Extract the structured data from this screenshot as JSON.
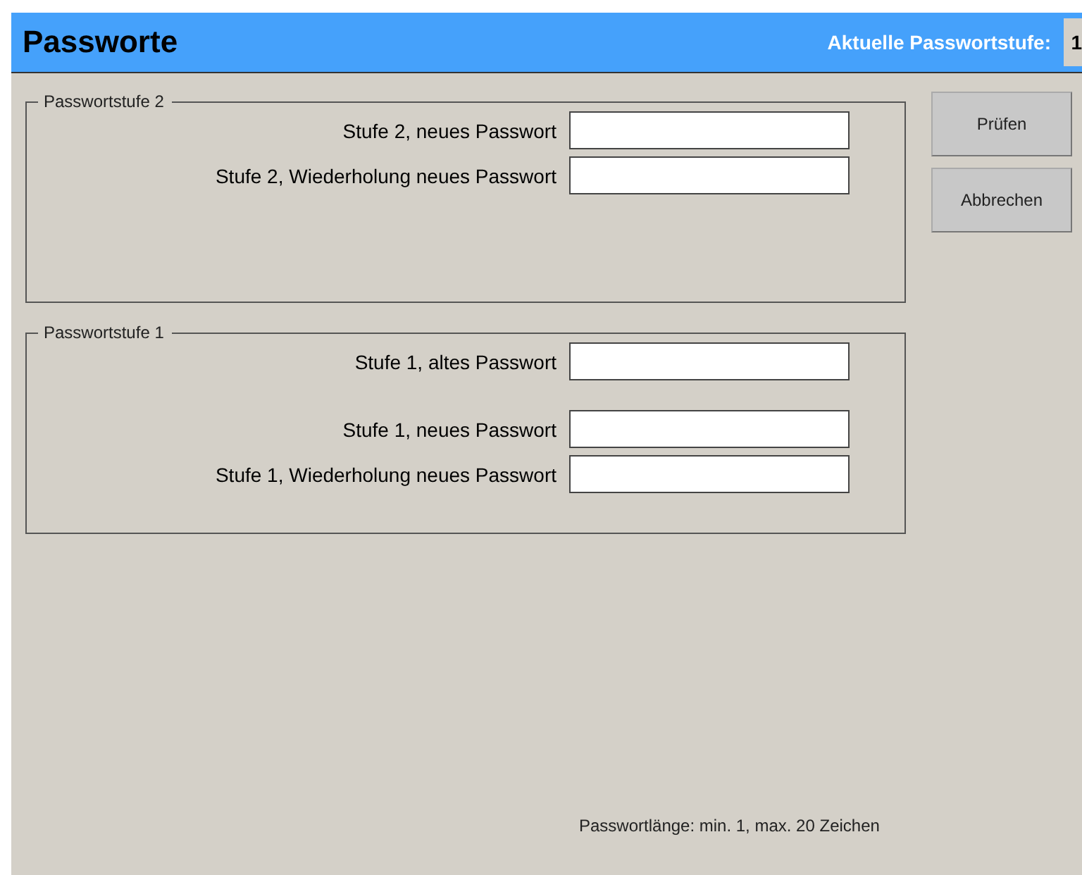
{
  "header": {
    "title": "Passworte",
    "level_label": "Aktuelle Passwortstufe:",
    "level_value": "1"
  },
  "groups": [
    {
      "title": "Passwortstufe 2",
      "blocks": [
        [
          {
            "label": "Stufe 2, neues Passwort"
          },
          {
            "label": "Stufe 2, Wiederholung neues Passwort"
          }
        ]
      ]
    },
    {
      "title": "Passwortstufe 1",
      "blocks": [
        [
          {
            "label": "Stufe 1, altes Passwort"
          }
        ],
        [
          {
            "label": "Stufe 1, neues Passwort"
          },
          {
            "label": "Stufe 1, Wiederholung neues Passwort"
          }
        ]
      ]
    }
  ],
  "buttons": [
    "Prüfen",
    "Abbrechen"
  ],
  "footer": "Passwortlänge: min. 1, max. 20 Zeichen"
}
